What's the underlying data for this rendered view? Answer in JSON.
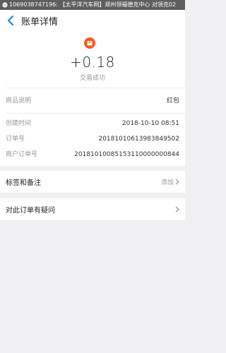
{
  "notification": {
    "icon": "message-icon",
    "text": "1069038747196: 【太平洋汽车网】郑州领福德克中心 对领克02"
  },
  "header": {
    "title": "账单详情",
    "back_icon": "chevron-left-icon"
  },
  "summary": {
    "icon": "red-envelope-icon",
    "amount": "+0.18",
    "status": "交易成功"
  },
  "details": {
    "product_label": "商品说明",
    "product_value": "红包",
    "created_label": "创建时间",
    "created_value": "2018-10-10 08:51",
    "order_label": "订单号",
    "order_value": "20181010613983849502",
    "merchant_order_label": "商户订单号",
    "merchant_order_value": "20181010085153110000000844"
  },
  "tags": {
    "label": "标签和备注",
    "action": "添加"
  },
  "question": {
    "label": "对此订单有疑问"
  },
  "colors": {
    "accent": "#1a7df0",
    "red_icon": "#f45a24",
    "background": "#f0f0f2"
  }
}
